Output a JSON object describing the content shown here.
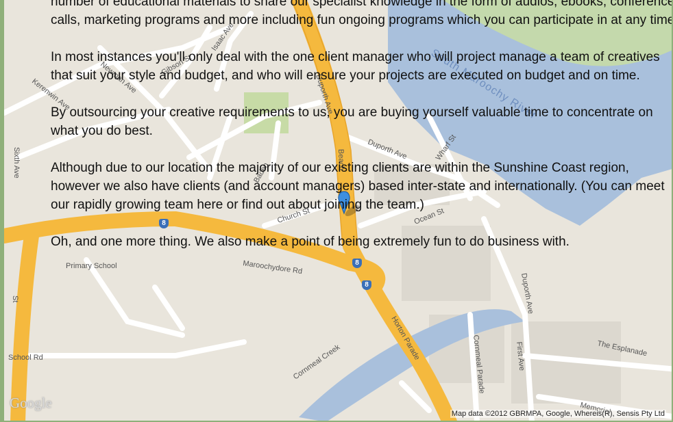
{
  "content": {
    "paragraphs": [
      "number of educational  materials to share our specialist knowledge in the form of audios,  ebooks,  conference calls, marketing programs and more including fun ongoing  programs which you can participate in at any time.",
      "In most instances you'll only deal with the one client manager who will  project manage a team of  creatives that suit your style and budget, and who will ensure your projects are executed on budget and on time.",
      "By outsourcing your creative requirements to us, you are buying yourself  valuable time to concentrate on what you do best.",
      "Although due to our location the majority of our existing clients are within  the Sunshine Coast region, however we also have clients (and account managers)  based inter-state and internationally. (You can  meet our rapidly growing team here or find out about joining the team.)",
      "Oh, and one more thing. We also make a point of being extremely fun to do  business with."
    ]
  },
  "map": {
    "streets": {
      "kerenwin": "Kerenwin Ave",
      "newman": "Newman Ave",
      "gibson": "Gibson St",
      "isaac": "Isaac Ave",
      "duporth_ave_vertical": "Duporth Ave",
      "beach": "Beach",
      "duporth_ave": "Duporth Ave",
      "wharf": "Wharf St",
      "baden": "Baden",
      "church": "Church St",
      "ocean": "Ocean St",
      "maroochydore": "Maroochydore Rd",
      "primary_school": "Primary School",
      "horton": "Horton Parade",
      "cornmeal_creek": "Cornmeal Creek",
      "cornmeal_parade": "Cornmeal Parade",
      "first_ave": "First Ave",
      "duporth_ave_lower": "Duporth Ave",
      "esplanade": "The Esplanade",
      "memorial": "Memorial",
      "school_rd": "School Rd",
      "st_left": "St",
      "sixth": "Sixth Ave"
    },
    "river_label": "South Maroochy River",
    "route_shields": [
      "8",
      "8",
      "8"
    ],
    "logo": "Google",
    "attribution": "Map data ©2012 GBRMPA, Google, Whereis(R), Sensis Pty Ltd",
    "colors": {
      "land": "#e9e5dc",
      "water": "#a9c0dc",
      "park": "#c7dba6",
      "major_road": "#f5b93e",
      "minor_road": "#ffffff",
      "marker": "#3d8fe0"
    }
  }
}
